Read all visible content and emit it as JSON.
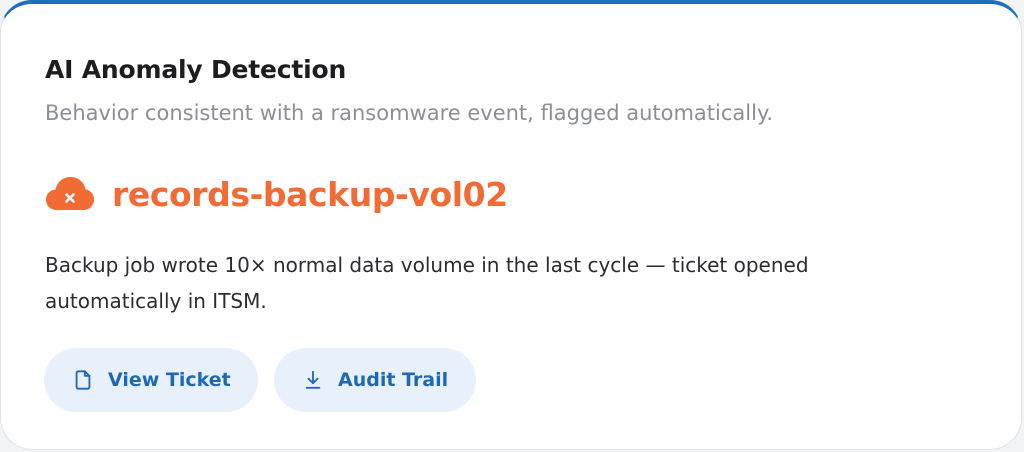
{
  "card": {
    "title": "AI Anomaly Detection",
    "subtitle": "Behavior consistent with a ransomware event, flagged automatically.",
    "resource": {
      "name": "records-backup-vol02",
      "icon": "cloud-error-icon",
      "color": "#f26a34"
    },
    "description": "Backup job wrote 10× normal data volume in the last cycle — ticket opened automatically in ITSM.",
    "actions": [
      {
        "label": "View Ticket",
        "icon": "document-icon"
      },
      {
        "label": "Audit Trail",
        "icon": "download-icon"
      }
    ],
    "colors": {
      "accent": "#1f6fbf",
      "button_bg": "#e8f1fb",
      "button_text": "#1e69b5"
    }
  }
}
